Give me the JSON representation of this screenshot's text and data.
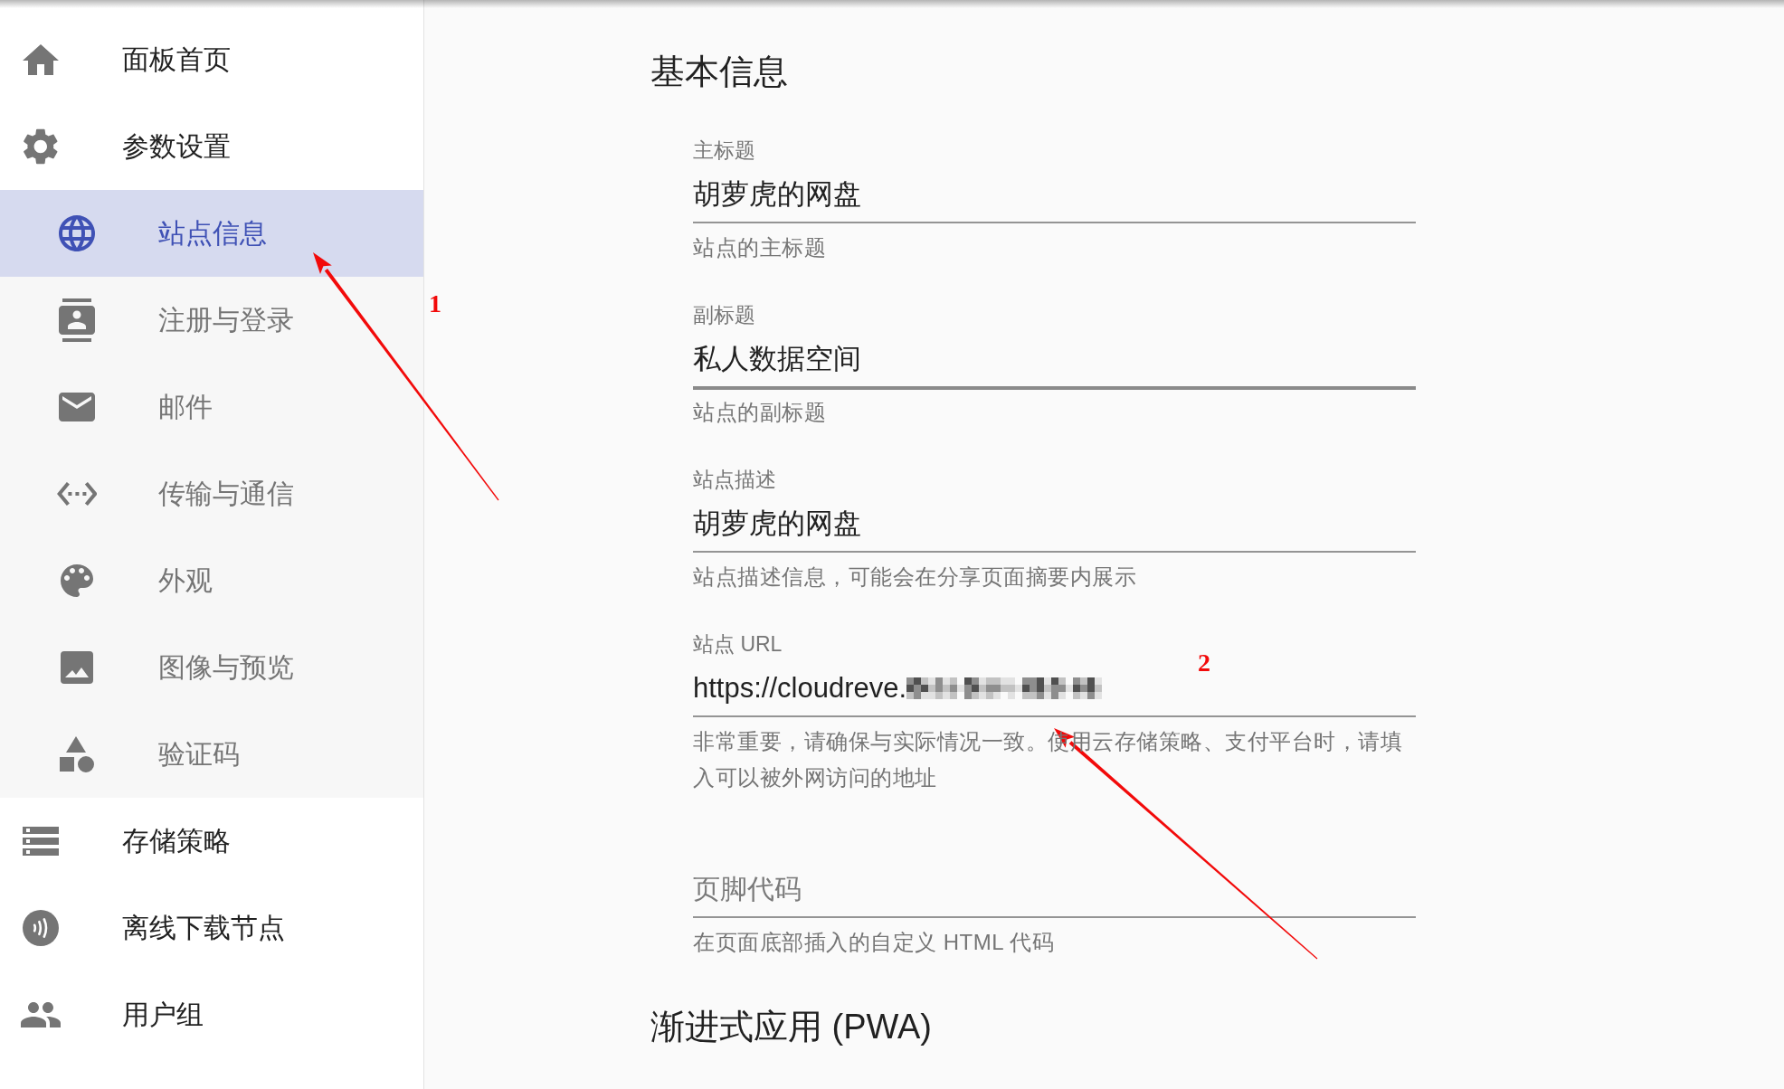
{
  "sidebar": {
    "items": [
      {
        "label": "面板首页",
        "selected": false
      },
      {
        "label": "参数设置",
        "selected": false,
        "expanded": true,
        "children": [
          {
            "label": "站点信息",
            "selected": true
          },
          {
            "label": "注册与登录",
            "selected": false
          },
          {
            "label": "邮件",
            "selected": false
          },
          {
            "label": "传输与通信",
            "selected": false
          },
          {
            "label": "外观",
            "selected": false
          },
          {
            "label": "图像与预览",
            "selected": false
          },
          {
            "label": "验证码",
            "selected": false
          }
        ]
      },
      {
        "label": "存储策略",
        "selected": false
      },
      {
        "label": "离线下载节点",
        "selected": false
      },
      {
        "label": "用户组",
        "selected": false
      }
    ]
  },
  "sections": [
    {
      "title": "基本信息",
      "fields": [
        {
          "label": "主标题",
          "value": "胡萝虎的网盘",
          "helper": "站点的主标题",
          "hovered": false,
          "redacted": false
        },
        {
          "label": "副标题",
          "value": "私人数据空间",
          "helper": "站点的副标题",
          "hovered": true,
          "redacted": false
        },
        {
          "label": "站点描述",
          "value": "胡萝虎的网盘",
          "helper": "站点描述信息，可能会在分享页面摘要内展示",
          "hovered": false,
          "redacted": false
        },
        {
          "label": "站点 URL",
          "value": "https://cloudreve.",
          "helper": "非常重要，请确保与实际情况一致。使用云存储策略、支付平台时，请填入可以被外网访问的地址",
          "hovered": false,
          "redacted": true
        },
        {
          "label": "页脚代码",
          "helper": "在页面底部插入的自定义 HTML 代码",
          "hovered": false,
          "redacted": false
        }
      ]
    },
    {
      "title": "渐进式应用 (PWA)"
    }
  ],
  "annotations": [
    {
      "label": "1"
    },
    {
      "label": "2"
    }
  ]
}
